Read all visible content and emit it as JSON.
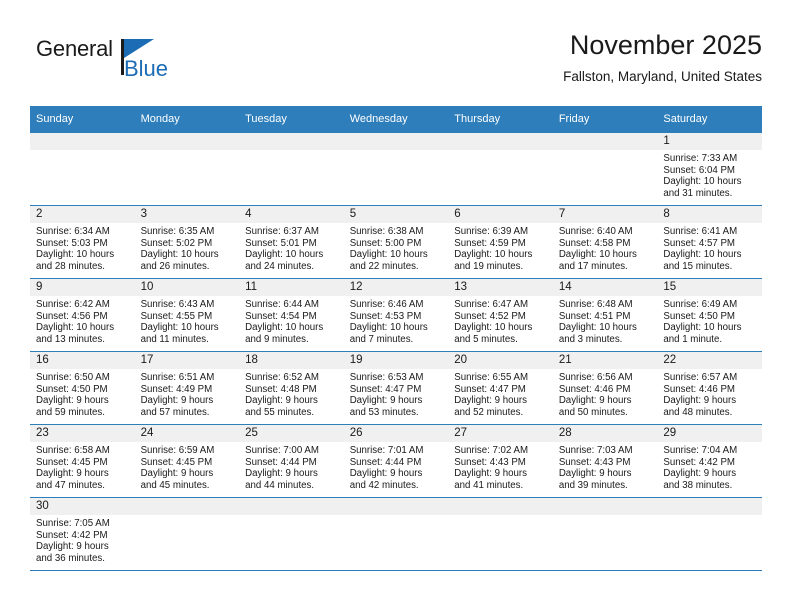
{
  "brand": {
    "name_top": "General",
    "name_bottom": "Blue",
    "accent_color": "#1b6bb5"
  },
  "header": {
    "title": "November 2025",
    "subtitle": "Fallston, Maryland, United States"
  },
  "theme": {
    "header_bg": "#2e7ebc",
    "daynum_bg": "#f0f0f0",
    "text_color": "#1a1a1a"
  },
  "calendar": {
    "weekday_headers": [
      "Sunday",
      "Monday",
      "Tuesday",
      "Wednesday",
      "Thursday",
      "Friday",
      "Saturday"
    ],
    "labels": {
      "sunrise": "Sunrise:",
      "sunset": "Sunset:",
      "daylight": "Daylight:"
    },
    "weeks": [
      [
        {
          "day": "",
          "sunrise": "",
          "sunset": "",
          "daylight_line1": "",
          "daylight_line2": ""
        },
        {
          "day": "",
          "sunrise": "",
          "sunset": "",
          "daylight_line1": "",
          "daylight_line2": ""
        },
        {
          "day": "",
          "sunrise": "",
          "sunset": "",
          "daylight_line1": "",
          "daylight_line2": ""
        },
        {
          "day": "",
          "sunrise": "",
          "sunset": "",
          "daylight_line1": "",
          "daylight_line2": ""
        },
        {
          "day": "",
          "sunrise": "",
          "sunset": "",
          "daylight_line1": "",
          "daylight_line2": ""
        },
        {
          "day": "",
          "sunrise": "",
          "sunset": "",
          "daylight_line1": "",
          "daylight_line2": ""
        },
        {
          "day": "1",
          "sunrise": "Sunrise: 7:33 AM",
          "sunset": "Sunset: 6:04 PM",
          "daylight_line1": "Daylight: 10 hours",
          "daylight_line2": "and 31 minutes."
        }
      ],
      [
        {
          "day": "2",
          "sunrise": "Sunrise: 6:34 AM",
          "sunset": "Sunset: 5:03 PM",
          "daylight_line1": "Daylight: 10 hours",
          "daylight_line2": "and 28 minutes."
        },
        {
          "day": "3",
          "sunrise": "Sunrise: 6:35 AM",
          "sunset": "Sunset: 5:02 PM",
          "daylight_line1": "Daylight: 10 hours",
          "daylight_line2": "and 26 minutes."
        },
        {
          "day": "4",
          "sunrise": "Sunrise: 6:37 AM",
          "sunset": "Sunset: 5:01 PM",
          "daylight_line1": "Daylight: 10 hours",
          "daylight_line2": "and 24 minutes."
        },
        {
          "day": "5",
          "sunrise": "Sunrise: 6:38 AM",
          "sunset": "Sunset: 5:00 PM",
          "daylight_line1": "Daylight: 10 hours",
          "daylight_line2": "and 22 minutes."
        },
        {
          "day": "6",
          "sunrise": "Sunrise: 6:39 AM",
          "sunset": "Sunset: 4:59 PM",
          "daylight_line1": "Daylight: 10 hours",
          "daylight_line2": "and 19 minutes."
        },
        {
          "day": "7",
          "sunrise": "Sunrise: 6:40 AM",
          "sunset": "Sunset: 4:58 PM",
          "daylight_line1": "Daylight: 10 hours",
          "daylight_line2": "and 17 minutes."
        },
        {
          "day": "8",
          "sunrise": "Sunrise: 6:41 AM",
          "sunset": "Sunset: 4:57 PM",
          "daylight_line1": "Daylight: 10 hours",
          "daylight_line2": "and 15 minutes."
        }
      ],
      [
        {
          "day": "9",
          "sunrise": "Sunrise: 6:42 AM",
          "sunset": "Sunset: 4:56 PM",
          "daylight_line1": "Daylight: 10 hours",
          "daylight_line2": "and 13 minutes."
        },
        {
          "day": "10",
          "sunrise": "Sunrise: 6:43 AM",
          "sunset": "Sunset: 4:55 PM",
          "daylight_line1": "Daylight: 10 hours",
          "daylight_line2": "and 11 minutes."
        },
        {
          "day": "11",
          "sunrise": "Sunrise: 6:44 AM",
          "sunset": "Sunset: 4:54 PM",
          "daylight_line1": "Daylight: 10 hours",
          "daylight_line2": "and 9 minutes."
        },
        {
          "day": "12",
          "sunrise": "Sunrise: 6:46 AM",
          "sunset": "Sunset: 4:53 PM",
          "daylight_line1": "Daylight: 10 hours",
          "daylight_line2": "and 7 minutes."
        },
        {
          "day": "13",
          "sunrise": "Sunrise: 6:47 AM",
          "sunset": "Sunset: 4:52 PM",
          "daylight_line1": "Daylight: 10 hours",
          "daylight_line2": "and 5 minutes."
        },
        {
          "day": "14",
          "sunrise": "Sunrise: 6:48 AM",
          "sunset": "Sunset: 4:51 PM",
          "daylight_line1": "Daylight: 10 hours",
          "daylight_line2": "and 3 minutes."
        },
        {
          "day": "15",
          "sunrise": "Sunrise: 6:49 AM",
          "sunset": "Sunset: 4:50 PM",
          "daylight_line1": "Daylight: 10 hours",
          "daylight_line2": "and 1 minute."
        }
      ],
      [
        {
          "day": "16",
          "sunrise": "Sunrise: 6:50 AM",
          "sunset": "Sunset: 4:50 PM",
          "daylight_line1": "Daylight: 9 hours",
          "daylight_line2": "and 59 minutes."
        },
        {
          "day": "17",
          "sunrise": "Sunrise: 6:51 AM",
          "sunset": "Sunset: 4:49 PM",
          "daylight_line1": "Daylight: 9 hours",
          "daylight_line2": "and 57 minutes."
        },
        {
          "day": "18",
          "sunrise": "Sunrise: 6:52 AM",
          "sunset": "Sunset: 4:48 PM",
          "daylight_line1": "Daylight: 9 hours",
          "daylight_line2": "and 55 minutes."
        },
        {
          "day": "19",
          "sunrise": "Sunrise: 6:53 AM",
          "sunset": "Sunset: 4:47 PM",
          "daylight_line1": "Daylight: 9 hours",
          "daylight_line2": "and 53 minutes."
        },
        {
          "day": "20",
          "sunrise": "Sunrise: 6:55 AM",
          "sunset": "Sunset: 4:47 PM",
          "daylight_line1": "Daylight: 9 hours",
          "daylight_line2": "and 52 minutes."
        },
        {
          "day": "21",
          "sunrise": "Sunrise: 6:56 AM",
          "sunset": "Sunset: 4:46 PM",
          "daylight_line1": "Daylight: 9 hours",
          "daylight_line2": "and 50 minutes."
        },
        {
          "day": "22",
          "sunrise": "Sunrise: 6:57 AM",
          "sunset": "Sunset: 4:46 PM",
          "daylight_line1": "Daylight: 9 hours",
          "daylight_line2": "and 48 minutes."
        }
      ],
      [
        {
          "day": "23",
          "sunrise": "Sunrise: 6:58 AM",
          "sunset": "Sunset: 4:45 PM",
          "daylight_line1": "Daylight: 9 hours",
          "daylight_line2": "and 47 minutes."
        },
        {
          "day": "24",
          "sunrise": "Sunrise: 6:59 AM",
          "sunset": "Sunset: 4:45 PM",
          "daylight_line1": "Daylight: 9 hours",
          "daylight_line2": "and 45 minutes."
        },
        {
          "day": "25",
          "sunrise": "Sunrise: 7:00 AM",
          "sunset": "Sunset: 4:44 PM",
          "daylight_line1": "Daylight: 9 hours",
          "daylight_line2": "and 44 minutes."
        },
        {
          "day": "26",
          "sunrise": "Sunrise: 7:01 AM",
          "sunset": "Sunset: 4:44 PM",
          "daylight_line1": "Daylight: 9 hours",
          "daylight_line2": "and 42 minutes."
        },
        {
          "day": "27",
          "sunrise": "Sunrise: 7:02 AM",
          "sunset": "Sunset: 4:43 PM",
          "daylight_line1": "Daylight: 9 hours",
          "daylight_line2": "and 41 minutes."
        },
        {
          "day": "28",
          "sunrise": "Sunrise: 7:03 AM",
          "sunset": "Sunset: 4:43 PM",
          "daylight_line1": "Daylight: 9 hours",
          "daylight_line2": "and 39 minutes."
        },
        {
          "day": "29",
          "sunrise": "Sunrise: 7:04 AM",
          "sunset": "Sunset: 4:42 PM",
          "daylight_line1": "Daylight: 9 hours",
          "daylight_line2": "and 38 minutes."
        }
      ],
      [
        {
          "day": "30",
          "sunrise": "Sunrise: 7:05 AM",
          "sunset": "Sunset: 4:42 PM",
          "daylight_line1": "Daylight: 9 hours",
          "daylight_line2": "and 36 minutes."
        },
        {
          "day": "",
          "sunrise": "",
          "sunset": "",
          "daylight_line1": "",
          "daylight_line2": ""
        },
        {
          "day": "",
          "sunrise": "",
          "sunset": "",
          "daylight_line1": "",
          "daylight_line2": ""
        },
        {
          "day": "",
          "sunrise": "",
          "sunset": "",
          "daylight_line1": "",
          "daylight_line2": ""
        },
        {
          "day": "",
          "sunrise": "",
          "sunset": "",
          "daylight_line1": "",
          "daylight_line2": ""
        },
        {
          "day": "",
          "sunrise": "",
          "sunset": "",
          "daylight_line1": "",
          "daylight_line2": ""
        },
        {
          "day": "",
          "sunrise": "",
          "sunset": "",
          "daylight_line1": "",
          "daylight_line2": ""
        }
      ]
    ]
  }
}
